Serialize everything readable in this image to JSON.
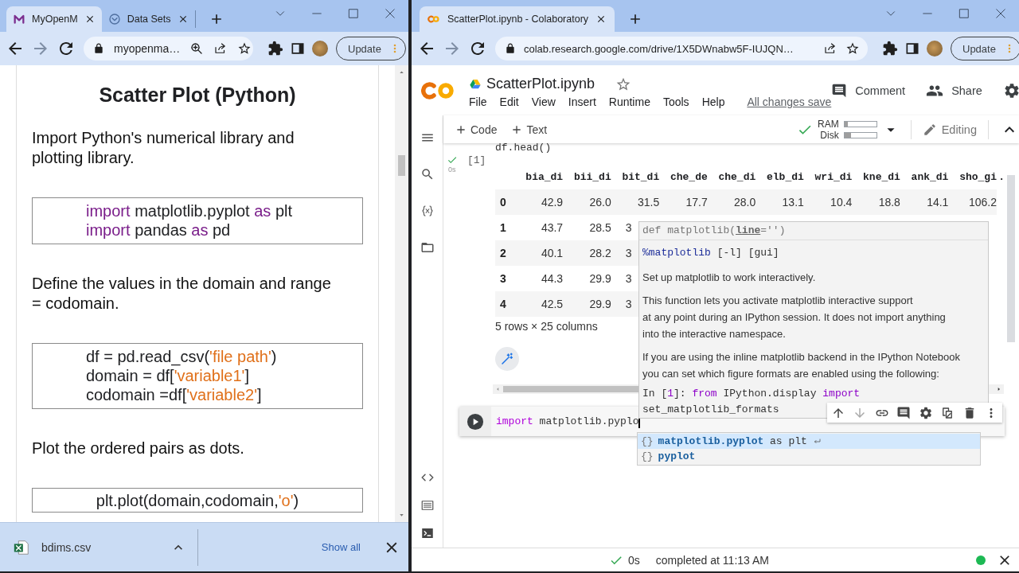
{
  "left_browser": {
    "tabs": [
      {
        "kind": "letter",
        "title": "MyOpenM",
        "selected": true
      },
      {
        "kind": "badge",
        "title": "Data Sets",
        "selected": false
      }
    ],
    "address": "myopenma…",
    "update_label": "Update",
    "page": {
      "title": "Scatter Plot (Python)",
      "blocks": [
        {
          "kind": "text",
          "text": "Import Python's numerical library and plotting library."
        },
        {
          "kind": "code",
          "lines": [
            [
              {
                "kind": "keyword",
                "text": "import"
              },
              {
                "kind": "plain",
                "text": " matplotlib.pyplot "
              },
              {
                "kind": "keyword",
                "text": "as"
              },
              {
                "kind": "plain",
                "text": " plt"
              }
            ],
            [
              {
                "kind": "keyword",
                "text": "import"
              },
              {
                "kind": "plain",
                "text": " pandas "
              },
              {
                "kind": "keyword",
                "text": "as"
              },
              {
                "kind": "plain",
                "text": " pd"
              }
            ]
          ]
        },
        {
          "kind": "text",
          "text": "Define the values in the domain and range = codomain."
        },
        {
          "kind": "code",
          "lines": [
            [
              {
                "kind": "plain",
                "text": "df = pd.read_csv("
              },
              {
                "kind": "string",
                "text": "'file path'"
              },
              {
                "kind": "plain",
                "text": ")"
              }
            ],
            [
              {
                "kind": "plain",
                "text": "domain = df["
              },
              {
                "kind": "string",
                "text": "'variable1'"
              },
              {
                "kind": "plain",
                "text": "]"
              }
            ],
            [
              {
                "kind": "plain",
                "text": "codomain =df["
              },
              {
                "kind": "string",
                "text": "'variable2'"
              },
              {
                "kind": "plain",
                "text": "]"
              }
            ]
          ]
        },
        {
          "kind": "text",
          "text": "Plot the ordered pairs as dots."
        },
        {
          "kind": "formula",
          "lines": [
            [
              {
                "kind": "plain",
                "text": "plt.plot(domain,codomain,"
              },
              {
                "kind": "string",
                "text": "'o'"
              },
              {
                "kind": "plain",
                "text": ")"
              }
            ]
          ]
        }
      ]
    },
    "download": {
      "file": "bdims.csv",
      "show_all": "Show all"
    }
  },
  "right_browser": {
    "tabs": [
      {
        "kind": "colab",
        "title": "ScatterPlot.ipynb - Colaboratory",
        "selected": true
      }
    ],
    "address": "colab.research.google.com/drive/1X5DWnabw5F-IUJQN…",
    "update_label": "Update",
    "header": {
      "notebook_name": "ScatterPlot.ipynb",
      "menus": [
        "File",
        "Edit",
        "View",
        "Insert",
        "Runtime",
        "Tools",
        "Help"
      ],
      "save_status": "All changes save",
      "comment": "Comment",
      "share": "Share"
    },
    "toolbar": {
      "add_code": "Code",
      "add_text": "Text",
      "ram": {
        "label": "RAM",
        "level": 0.1
      },
      "disk": {
        "label": "Disk",
        "level": 0.2
      },
      "mode": "Editing"
    },
    "notebook": {
      "prev_code": "df.head()",
      "exec_count": "[1]",
      "exec_time": "0s",
      "table": {
        "columns": [
          "bia_di",
          "bii_di",
          "bit_di",
          "che_de",
          "che_di",
          "elb_di",
          "wri_di",
          "kne_di",
          "ank_di",
          "sho_gi",
          "."
        ],
        "rows": [
          {
            "index": "0",
            "values": [
              "42.9",
              "26.0",
              "31.5",
              "17.7",
              "28.0",
              "13.1",
              "10.4",
              "18.8",
              "14.1",
              "106.2"
            ]
          },
          {
            "index": "1",
            "values": [
              "43.7",
              "28.5",
              "3"
            ]
          },
          {
            "index": "2",
            "values": [
              "40.1",
              "28.2",
              "3"
            ]
          },
          {
            "index": "3",
            "values": [
              "44.3",
              "29.9",
              "3"
            ]
          },
          {
            "index": "4",
            "values": [
              "42.5",
              "29.9",
              "3"
            ]
          }
        ]
      },
      "footer": "5 rows × 25 columns",
      "input": [
        {
          "kind": "keyword",
          "text": "import"
        },
        {
          "kind": "plain",
          "text": " matplotlib.pyplo"
        }
      ],
      "tooltip": [
        {
          "kind": "signature",
          "text": "def matplotlib(**line**='')"
        },
        {
          "kind": "usage",
          "tokens": [
            {
              "kind": "magic",
              "text": "%matplotlib"
            },
            {
              "kind": "plain",
              "text": " [-l] [gui]"
            }
          ]
        },
        {
          "kind": "prose",
          "text": "Set up matplotlib to work interactively."
        },
        {
          "kind": "prose",
          "text": "This function lets you activate matplotlib interactive support\nat any point during an IPython session. It does not import anything\ninto the interactive namespace."
        },
        {
          "kind": "prose",
          "text": "If you are using the inline matplotlib backend in the IPython Notebook\nyou can set which figure formats are enabled using the following:"
        },
        {
          "kind": "code",
          "lines": [
            [
              {
                "kind": "plain",
                "text": "In ["
              },
              {
                "kind": "keyword",
                "text": "1"
              },
              {
                "kind": "plain",
                "text": "]: "
              },
              {
                "kind": "keyword",
                "text": "from"
              },
              {
                "kind": "plain",
                "text": " IPython.display "
              },
              {
                "kind": "keyword",
                "text": "import"
              }
            ],
            [
              {
                "kind": "plain",
                "text": "set_matplotlib_formats"
              }
            ]
          ]
        }
      ],
      "completions": [
        {
          "symbol": "{}",
          "match": "matplotlib.pyplot",
          "rest": " as plt",
          "selected": true
        },
        {
          "symbol": "{}",
          "match": "pyplot",
          "selected": false
        }
      ]
    },
    "status": {
      "time": "0s",
      "message": "completed at 11:13 AM"
    }
  }
}
